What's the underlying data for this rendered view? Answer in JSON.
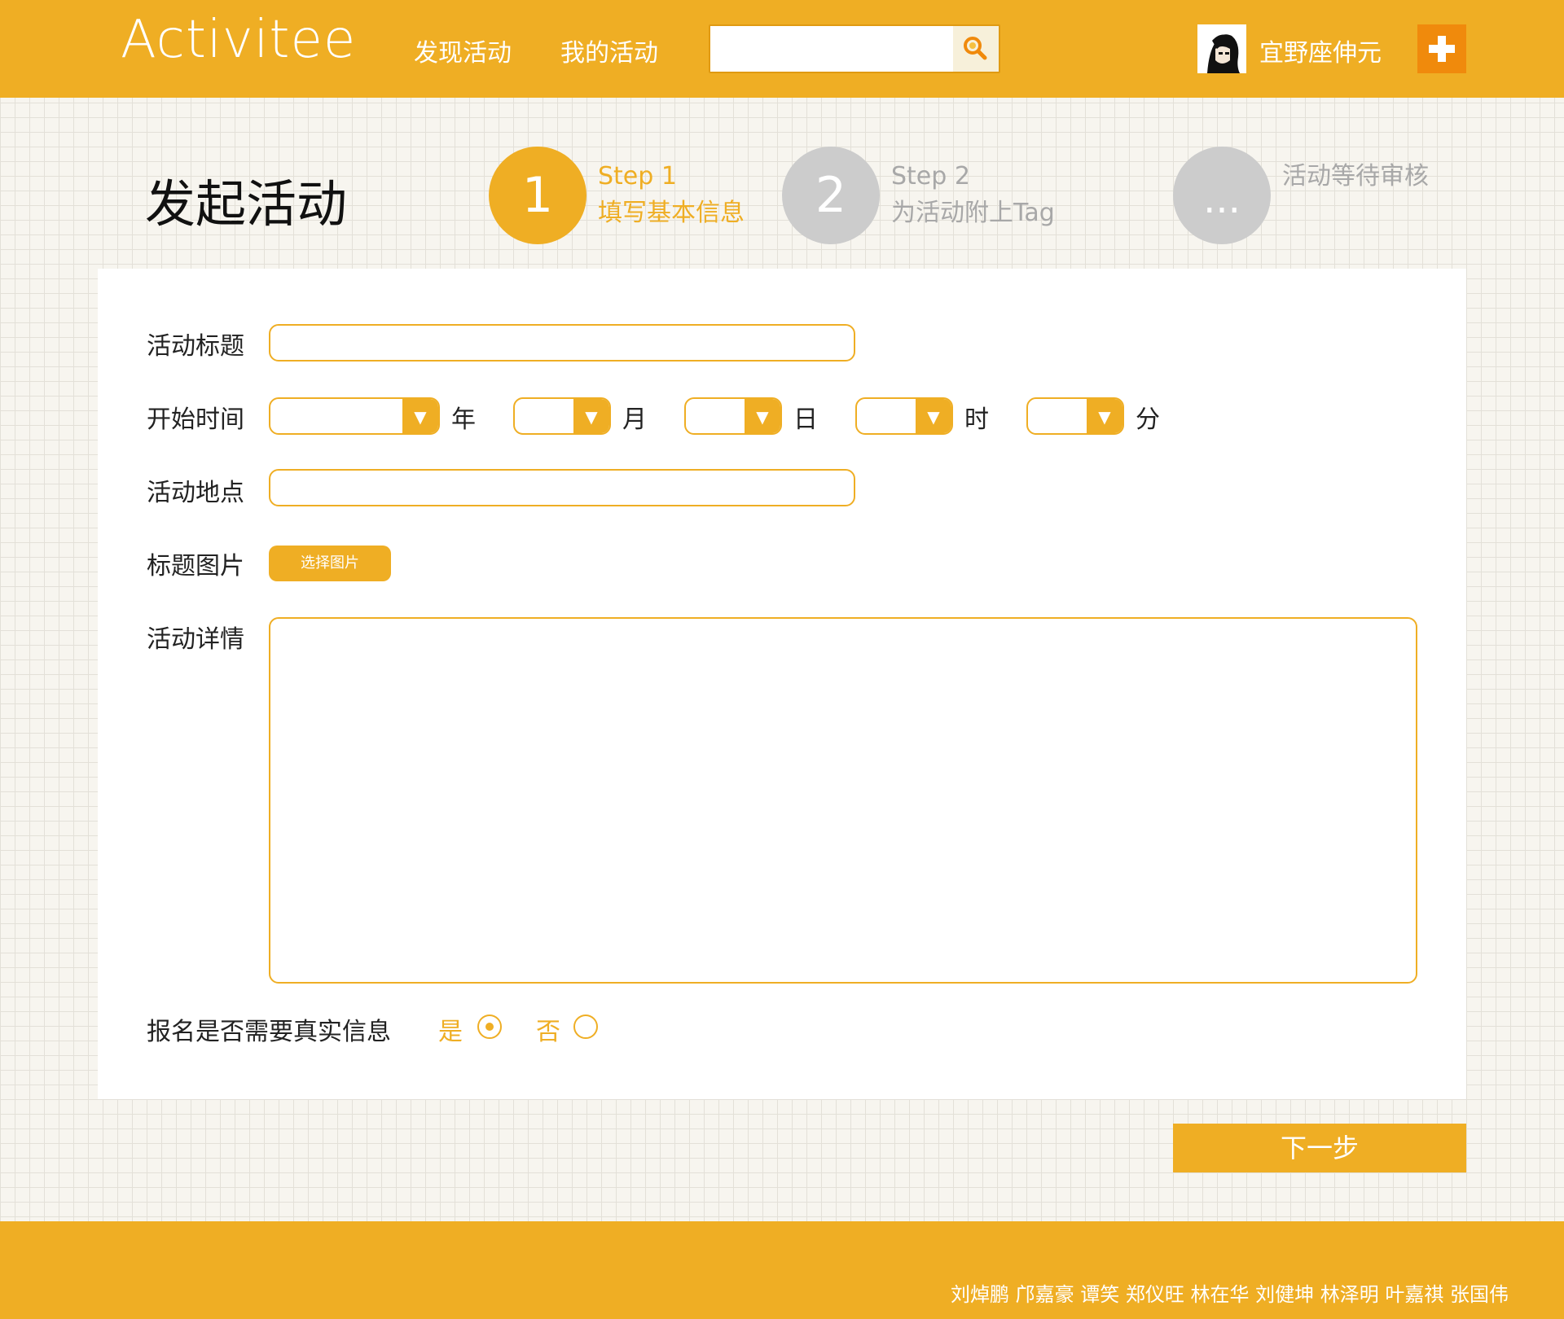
{
  "header": {
    "logo": "Activitee",
    "nav": [
      "发现活动",
      "我的活动"
    ],
    "search_value": "",
    "username": "宜野座伸元"
  },
  "page": {
    "title": "发起活动",
    "steps": [
      {
        "number": "1",
        "title": "Step 1",
        "subtitle": "填写基本信息",
        "active": true
      },
      {
        "number": "2",
        "title": "Step 2",
        "subtitle": "为活动附上Tag",
        "active": false
      },
      {
        "number": "...",
        "title": "活动等待审核",
        "subtitle": "",
        "active": false
      }
    ]
  },
  "form": {
    "labels": {
      "title": "活动标题",
      "start_time": "开始时间",
      "location": "活动地点",
      "cover_image": "标题图片",
      "details": "活动详情",
      "real_info": "报名是否需要真实信息"
    },
    "time_units": [
      "年",
      "月",
      "日",
      "时",
      "分"
    ],
    "choose_image_label": "选择图片",
    "radio_options": [
      {
        "label": "是",
        "selected": true
      },
      {
        "label": "否",
        "selected": false
      }
    ]
  },
  "next_button": "下一步",
  "footer": {
    "credits": "刘焯鹏  邝嘉豪  谭笑  郑仪旺  林在华  刘健坤  林泽明  叶嘉祺  张国伟"
  },
  "colors": {
    "accent": "#efae24",
    "accent_dark": "#f08a0c",
    "inactive_step": "#cccccc",
    "inactive_text": "#a8a8a8"
  }
}
